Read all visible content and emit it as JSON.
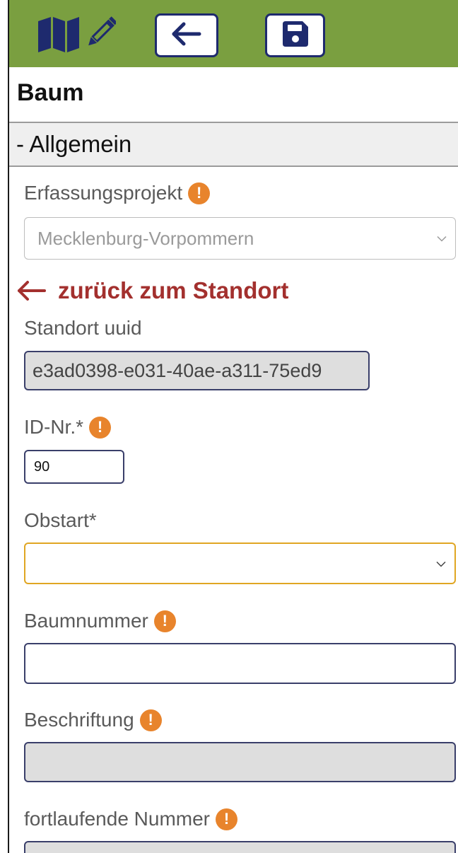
{
  "toolbar": {
    "map_edit_icon": "map-pencil-icon",
    "back_icon": "arrow-left-icon",
    "save_icon": "floppy-disk-icon"
  },
  "page": {
    "title": "Baum"
  },
  "section": {
    "label": "- Allgemein"
  },
  "fields": {
    "erfassungsprojekt": {
      "label": "Erfassungsprojekt",
      "value": "Mecklenburg-Vorpommern"
    },
    "back_link": "zurück zum Standort",
    "standort_uuid": {
      "label": "Standort uuid",
      "value": "e3ad0398-e031-40ae-a311-75ed9"
    },
    "id_nr": {
      "label": "ID-Nr.*",
      "value": "90"
    },
    "obstart": {
      "label": "Obstart*",
      "value": ""
    },
    "baumnummer": {
      "label": "Baumnummer",
      "value": ""
    },
    "beschriftung": {
      "label": "Beschriftung",
      "value": ""
    },
    "fortlaufende_nummer": {
      "label": "fortlaufende Nummer",
      "value": ""
    }
  },
  "colors": {
    "toolbar_bg": "#7a9f40",
    "navy": "#1e2a6e",
    "warning": "#e8842c",
    "link_red": "#a3302e",
    "required_border": "#e0a623"
  }
}
